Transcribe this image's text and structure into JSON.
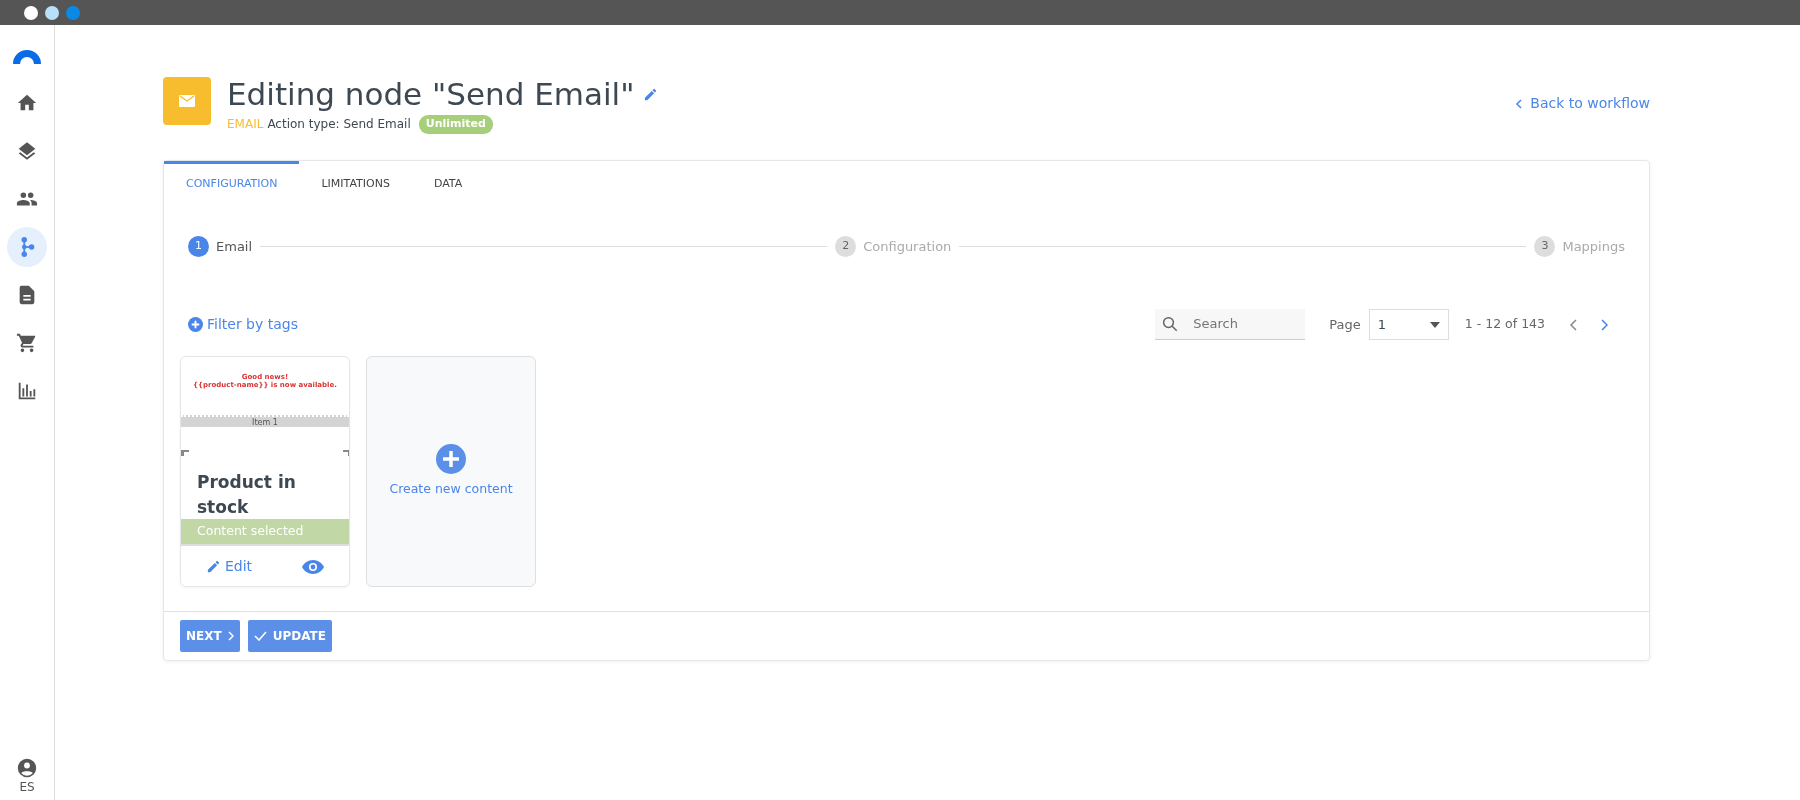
{
  "sidebar": {
    "items": [
      {
        "kind": "home",
        "selected": false
      },
      {
        "kind": "layers",
        "selected": false
      },
      {
        "kind": "people",
        "selected": false
      },
      {
        "kind": "workflow",
        "selected": true
      },
      {
        "kind": "document",
        "selected": false
      },
      {
        "kind": "cart",
        "selected": false
      },
      {
        "kind": "chart",
        "selected": false
      }
    ],
    "user": {
      "label": "ES"
    }
  },
  "header": {
    "title": "Editing node \"Send Email\"",
    "type_tag": "EMAIL",
    "action_type": "Action type: Send Email",
    "badge": "Unlimited",
    "back_link": "Back to workflow"
  },
  "tabs": [
    {
      "label": "CONFIGURATION",
      "selected": true
    },
    {
      "label": "LIMITATIONS",
      "selected": false
    },
    {
      "label": "DATA",
      "selected": false
    }
  ],
  "steps": [
    {
      "number": "1",
      "label": "Email",
      "selected": true
    },
    {
      "number": "2",
      "label": "Configuration",
      "selected": false
    },
    {
      "number": "3",
      "label": "Mappings",
      "selected": false
    }
  ],
  "toolbar": {
    "filter": "Filter by tags",
    "search_placeholder": "Search",
    "page_label": "Page",
    "page_value": "1",
    "range": "1 - 12 of 143"
  },
  "contents": [
    {
      "kind": "template",
      "preview": {
        "headline": "Good news!",
        "subline": "{{product-name}} is now available.",
        "item": "Item 1"
      },
      "title": "Product in stock",
      "selected": true,
      "status": "Content selected",
      "edit": "Edit"
    },
    {
      "kind": "create",
      "label": "Create new content"
    }
  ],
  "footer": {
    "buttons": [
      {
        "kind": "next",
        "label": "NEXT"
      },
      {
        "kind": "update",
        "label": "UPDATE"
      }
    ]
  }
}
